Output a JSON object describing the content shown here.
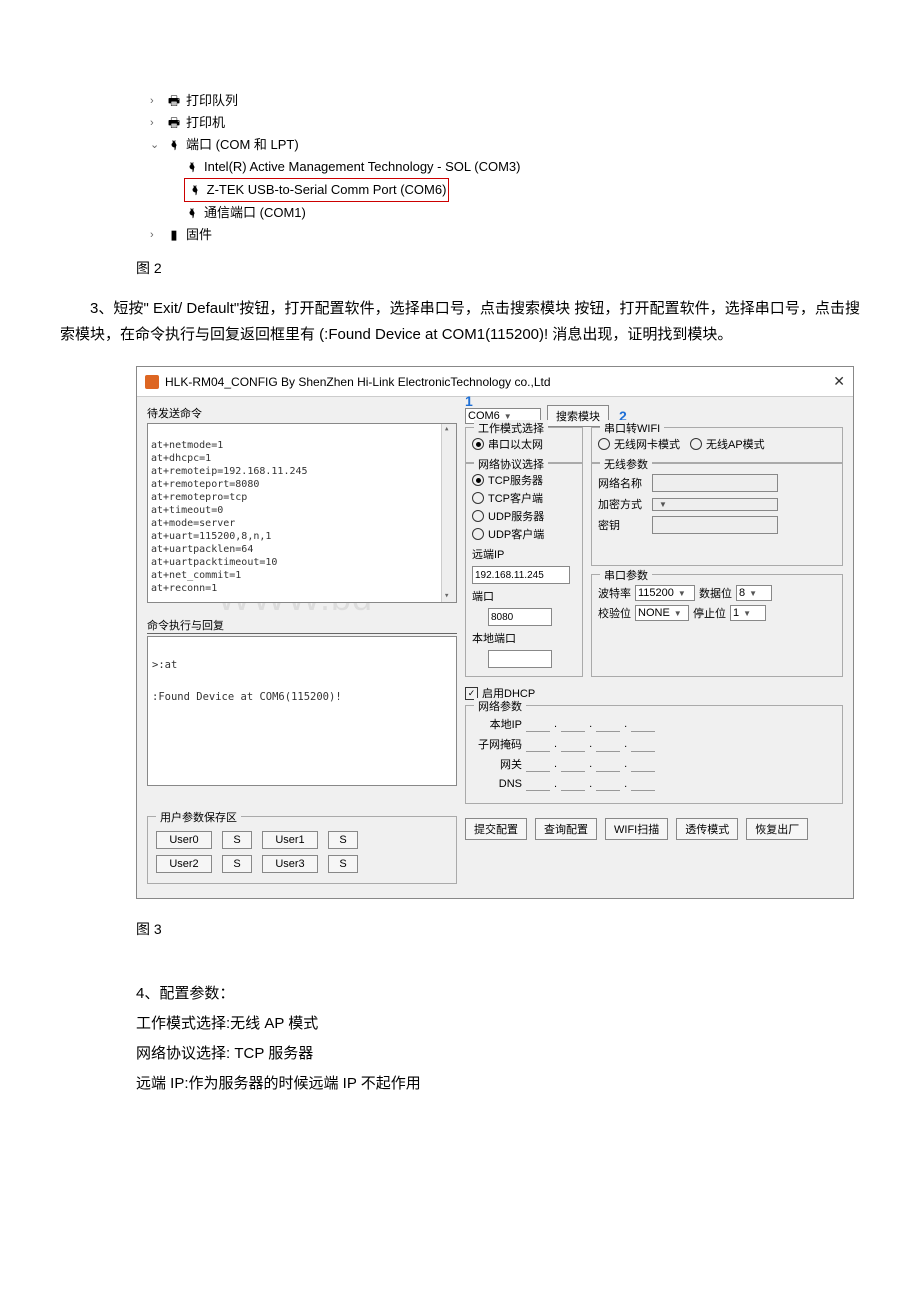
{
  "tree": {
    "print_queue": "打印队列",
    "printers": "打印机",
    "ports": "端口 (COM 和 LPT)",
    "intel": "Intel(R) Active Management Technology - SOL (COM3)",
    "ztek": "Z-TEK USB-to-Serial Comm Port (COM6)",
    "comm1": "通信端口 (COM1)",
    "firmware": "固件"
  },
  "fig2": "图 2",
  "para3": "3、短按\" Exit/ Default\"按钮，打开配置软件，选择串口号，点击搜索模块 按钮，打开配置软件，选择串口号，点击搜索模块，在命令执行与回复返回框里有 (:Found Device at COM1(115200)! 消息出现，证明找到模块。",
  "cfg": {
    "title": "HLK-RM04_CONFIG By ShenZhen Hi-Link ElectronicTechnology co.,Ltd",
    "badge1": "1",
    "badge2": "2",
    "pending_label": "待发送命令",
    "cmds": "at+netmode=1\nat+dhcpc=1\nat+remoteip=192.168.11.245\nat+remoteport=8080\nat+remotepro=tcp\nat+timeout=0\nat+mode=server\nat+uart=115200,8,n,1\nat+uartpacklen=64\nat+uartpacktimeout=10\nat+net_commit=1\nat+reconn=1",
    "reply_label": "命令执行与回复",
    "reply": ">:at\n\n:Found Device at COM6(115200)!",
    "watermark": "WWW.bd",
    "user_save_title": "用户参数保存区",
    "user_btns": [
      "User0",
      "User1",
      "User2",
      "User3"
    ],
    "s_label": "S",
    "com_port": "COM6",
    "search_btn": "搜索模块",
    "workmode_title": "工作模式选择",
    "eth_label": "串口以太网",
    "wifi_group": "串口转WIFI",
    "wifi_card": "无线网卡模式",
    "wifi_ap": "无线AP模式",
    "proto_title": "网络协议选择",
    "proto_opts": [
      "TCP服务器",
      "TCP客户端",
      "UDP服务器",
      "UDP客户端"
    ],
    "remote_ip_lbl": "远端IP",
    "remote_ip": "192.168.11.245",
    "port_lbl": "端口",
    "port": "8080",
    "local_port_lbl": "本地端口",
    "dhcp_enable": "启用DHCP",
    "wireless_title": "无线参数",
    "ssid_lbl": "网络名称",
    "enc_lbl": "加密方式",
    "key_lbl": "密钥",
    "serial_title": "串口参数",
    "baud_lbl": "波特率",
    "baud_val": "115200",
    "databits_lbl": "数据位",
    "databits_val": "8",
    "parity_lbl": "校验位",
    "parity_val": "NONE",
    "stopbits_lbl": "停止位",
    "stopbits_val": "1",
    "net_title": "网络参数",
    "localip_lbl": "本地IP",
    "mask_lbl": "子网掩码",
    "gateway_lbl": "网关",
    "dns_lbl": "DNS",
    "btns": [
      "提交配置",
      "查询配置",
      "WIFI扫描",
      "透传模式",
      "恢复出厂"
    ]
  },
  "fig3": "图 3",
  "sec4_title": "4、配置参数：",
  "sec4_l1": "工作模式选择:无线 AP 模式",
  "sec4_l2": "网络协议选择: TCP 服务器",
  "sec4_l3": "远端 IP:作为服务器的时候远端 IP 不起作用"
}
